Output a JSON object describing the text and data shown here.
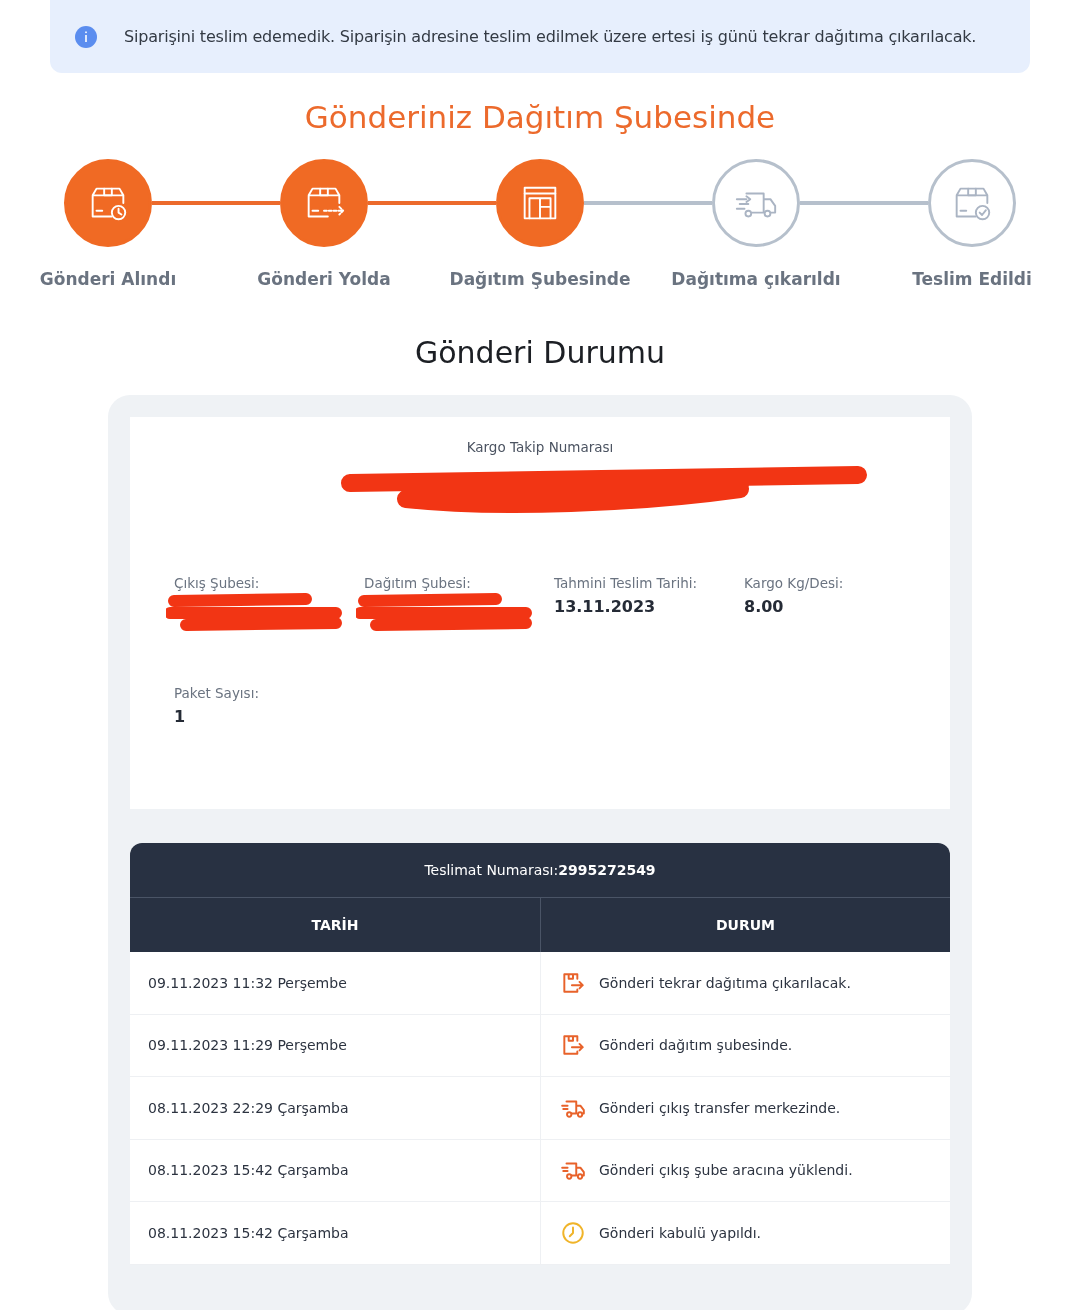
{
  "alert": {
    "text": "Siparişini teslim edemedik. Siparişin adresine teslim edilmek üzere ertesi iş günü tekrar dağıtıma çıkarılacak."
  },
  "status_title": "Gönderiniz Dağıtım Şubesinde",
  "steps": [
    {
      "label": "Gönderi Alındı",
      "kind": "box-clock",
      "done": true
    },
    {
      "label": "Gönderi Yolda",
      "kind": "box-arrow",
      "done": true
    },
    {
      "label": "Dağıtım Şubesinde",
      "kind": "warehouse",
      "done": true
    },
    {
      "label": "Dağıtıma çıkarıldı",
      "kind": "truck",
      "done": false
    },
    {
      "label": "Teslim Edildi",
      "kind": "box-check",
      "done": false
    }
  ],
  "section_title": "Gönderi Durumu",
  "details": {
    "tracking_label": "Kargo Takip Numarası",
    "fields": [
      {
        "label": "Çıkış Şubesi:",
        "redacted": true
      },
      {
        "label": "Dağıtım Şubesi:",
        "redacted": true
      },
      {
        "label": "Tahmini Teslim Tarihi:",
        "value": "13.11.2023",
        "redacted": false
      },
      {
        "label": "Kargo Kg/Desi:",
        "value": "8.00",
        "redacted": false
      },
      {
        "label": "Paket Sayısı:",
        "value": "1",
        "redacted": false
      }
    ]
  },
  "table": {
    "delivery_label": "Teslimat Numarası:",
    "delivery_number": "2995272549",
    "columns": [
      "TARİH",
      "DURUM"
    ],
    "rows": [
      {
        "date": "09.11.2023 11:32 Perşembe",
        "status": "Gönderi tekrar dağıtıma çıkarılacak.",
        "kind": "box-arrow"
      },
      {
        "date": "09.11.2023 11:29 Perşembe",
        "status": "Gönderi dağıtım şubesinde.",
        "kind": "box-arrow"
      },
      {
        "date": "08.11.2023 22:29 Çarşamba",
        "status": "Gönderi çıkış transfer merkezinde.",
        "kind": "truck"
      },
      {
        "date": "08.11.2023 15:42 Çarşamba",
        "status": "Gönderi çıkış şube aracına yüklendi.",
        "kind": "truck"
      },
      {
        "date": "08.11.2023 15:42 Çarşamba",
        "status": "Gönderi kabulü yapıldı.",
        "kind": "clock"
      }
    ]
  }
}
